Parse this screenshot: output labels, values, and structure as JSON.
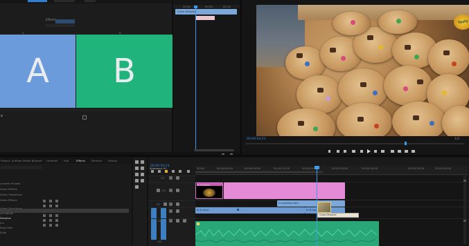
{
  "source_monitor": {
    "letters": [
      "A",
      "B"
    ],
    "colors": {
      "a": "#6c9bdc",
      "b": "#20b37b"
    },
    "header_labels": [
      "Effects",
      "Sequence"
    ]
  },
  "effect_list": {
    "row_label": "Cross Dissolve"
  },
  "program_monitor": {
    "timecode": "00:00:04:23",
    "end_label": "1/2",
    "logo_text": "Tasty"
  },
  "project_panel": {
    "tabs": [
      "Project: Untitled",
      "Media Browser",
      "Libraries",
      "Info",
      "Effects",
      "Markers",
      "History"
    ],
    "rows": [
      "Lumetri Presets",
      "Audio Effects",
      "Audio Transitions",
      "Video Effects",
      "Video Transitions",
      "3D Motion",
      "Dissolve",
      "Iris",
      "Page Peel",
      "Slide"
    ]
  },
  "timeline": {
    "tab": "Sequence 01",
    "timecode": "00:00:04:23",
    "ruler": [
      "00:00",
      "00:00:05:00",
      "00:00:10:00",
      "00:00:15:00",
      "00:00:20:00",
      "00:00:25:00",
      "00:00:30:00",
      "00:00:35:00",
      "00:00:40:00"
    ],
    "clip_labels": [
      "fx Graphic",
      "fx cookies.mp4",
      "fx A.mp4",
      "fx B.mp4",
      "Cross Dissolve"
    ],
    "tracks": [
      "V3",
      "V2",
      "V1",
      "A1",
      "A2"
    ]
  },
  "colors": {
    "accent": "#2f7fd3",
    "playhead": "#3d9be9",
    "clip_pink": "#e48ad6",
    "clip_blue": "#7ba7db",
    "audio_green": "#2aa778"
  }
}
